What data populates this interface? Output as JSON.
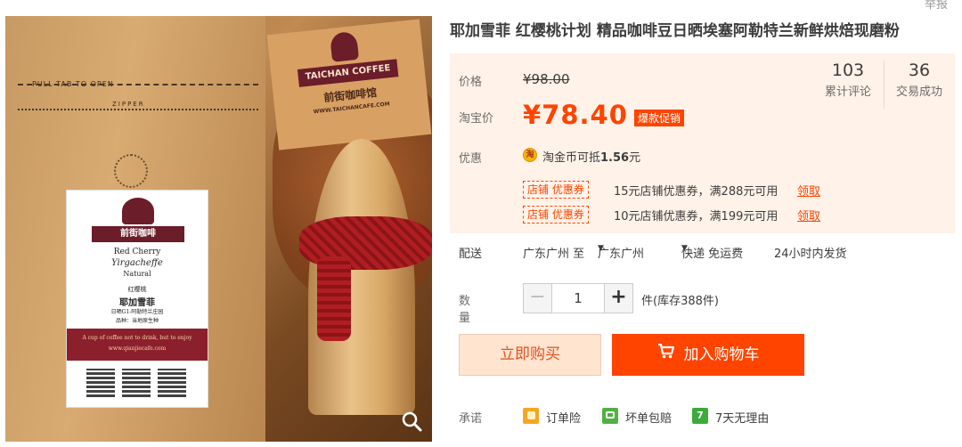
{
  "header": {
    "corner_link": "举报"
  },
  "product": {
    "title": "耶加雪菲 红樱桃计划 精品咖啡豆日晒埃塞阿勒特兰新鲜烘焙现磨粉",
    "image": {
      "bag_pull_tab": "PULL TAB TO OPEN",
      "bag_zipper": "ZIPPER",
      "label_brand": "前街咖啡",
      "label_line1": "Red Cherry",
      "label_line2": "Yirgacheffe",
      "label_line3": "Natural",
      "label_cn1": "红樱桃",
      "label_cn2": "耶加雪菲",
      "label_cn3": "日晒G1-阿勒特兰庄园",
      "label_cn4": "品种：当地原生种",
      "label_slogan": "A cup of coffee not to drink, but to enjoy",
      "label_site": "www.qianjiecafe.com",
      "tag_brand": "TAICHAN COFFEE",
      "tag_cn": "前街咖啡馆",
      "tag_url": "WWW.TAICHANCAFE.COM"
    }
  },
  "price": {
    "label": "价格",
    "original": "¥98.00",
    "promo_label": "淘宝价",
    "current": "¥78.40",
    "badge": "爆款促销",
    "reviews_count": "103",
    "reviews_label": "累计评论",
    "sales_count": "36",
    "sales_label": "交易成功"
  },
  "discount": {
    "label": "优惠",
    "coin_icon": "淘",
    "coin_text_prefix": "淘金币可抵",
    "coin_amount": "1.56",
    "coin_text_suffix": "元",
    "coupons": [
      {
        "tag": "店铺 优惠券",
        "desc": "15元店铺优惠券，满288元可用",
        "link": "领取"
      },
      {
        "tag": "店铺 优惠券",
        "desc": "10元店铺优惠券，满199元可用",
        "link": "领取"
      }
    ]
  },
  "shipping": {
    "label": "配送",
    "from": "广东广州 至",
    "to": "广东广州",
    "method": "快递 免运费",
    "time": "24小时内发货"
  },
  "quantity": {
    "label": "数量",
    "minus": "−",
    "value": "1",
    "plus": "+",
    "stock": "件(库存388件)"
  },
  "actions": {
    "buy_now": "立即购买",
    "add_cart": "加入购物车"
  },
  "promise": {
    "label": "承诺",
    "items": [
      {
        "icon": "order-insurance-icon",
        "text": "订单险",
        "color": "#f5a623"
      },
      {
        "icon": "broken-guarantee-icon",
        "text": "坏单包赔",
        "color": "#52b043"
      },
      {
        "icon": "seven-day-return-icon",
        "text": "7天无理由",
        "color": "#3daa3c",
        "glyph": "7"
      }
    ]
  },
  "colors": {
    "accent": "#ff4400",
    "price_bg": "#fff2e8"
  }
}
